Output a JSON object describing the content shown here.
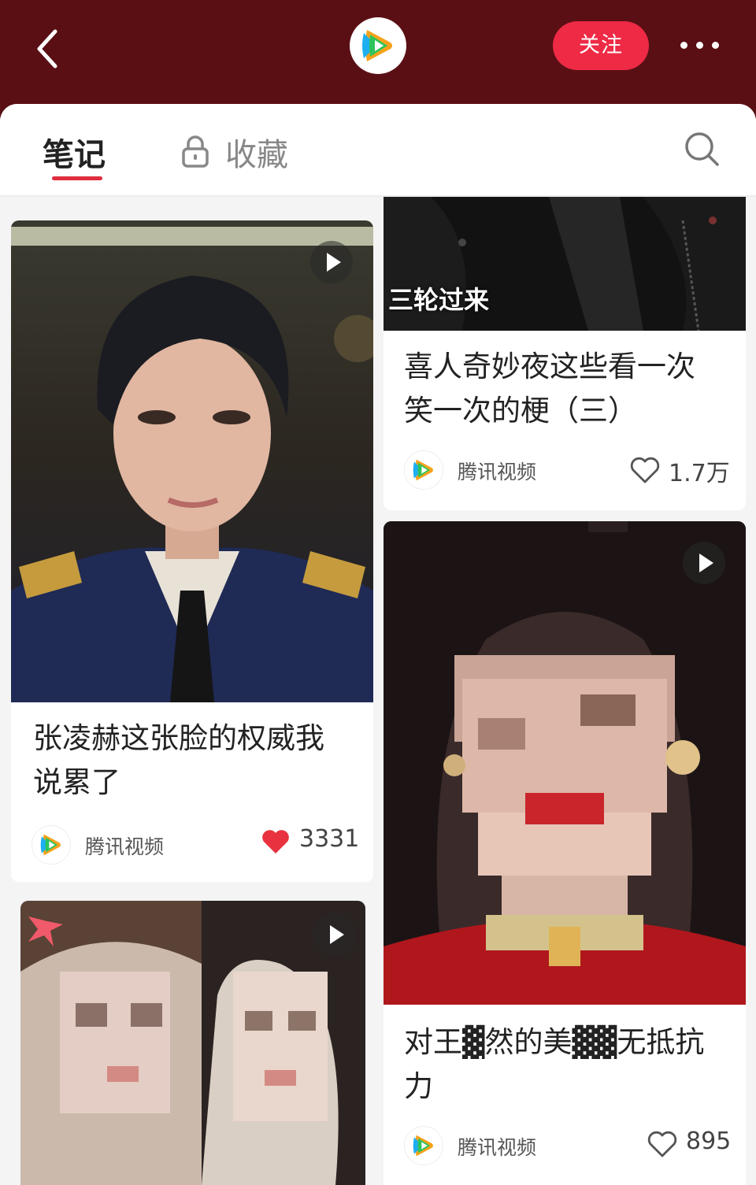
{
  "header": {
    "follow_label": "关注",
    "icons": [
      "back-chevron-icon",
      "tencent-video-logo",
      "more-dots-icon"
    ]
  },
  "tabs": {
    "notes_label": "笔记",
    "favorites_label": "收藏",
    "favorites_locked": true,
    "active": "笔记"
  },
  "cards": [
    {
      "title_line1": "喜人奇妙夜这些看一次",
      "title_line2": "笑一次的梗（三）",
      "image_caption": "三轮过来",
      "author": "腾讯视频",
      "likes": "1.7万",
      "liked": false,
      "is_video": false
    },
    {
      "title_line1": "张凌赫这张脸的权威我",
      "title_line2": "说累了",
      "author": "腾讯视频",
      "likes": "3331",
      "liked": true,
      "is_video": true
    },
    {
      "title_line1": "对王▓然的美▓▓无抵抗",
      "title_line2": "力",
      "author": "腾讯视频",
      "likes": "895",
      "liked": false,
      "is_video": true
    },
    {
      "is_video": true
    }
  ],
  "colors": {
    "header_bg": "#5a0f14",
    "follow_bg": "#ee2a45",
    "tab_underline": "#e02e3e",
    "liked_heart": "#e8323f"
  }
}
